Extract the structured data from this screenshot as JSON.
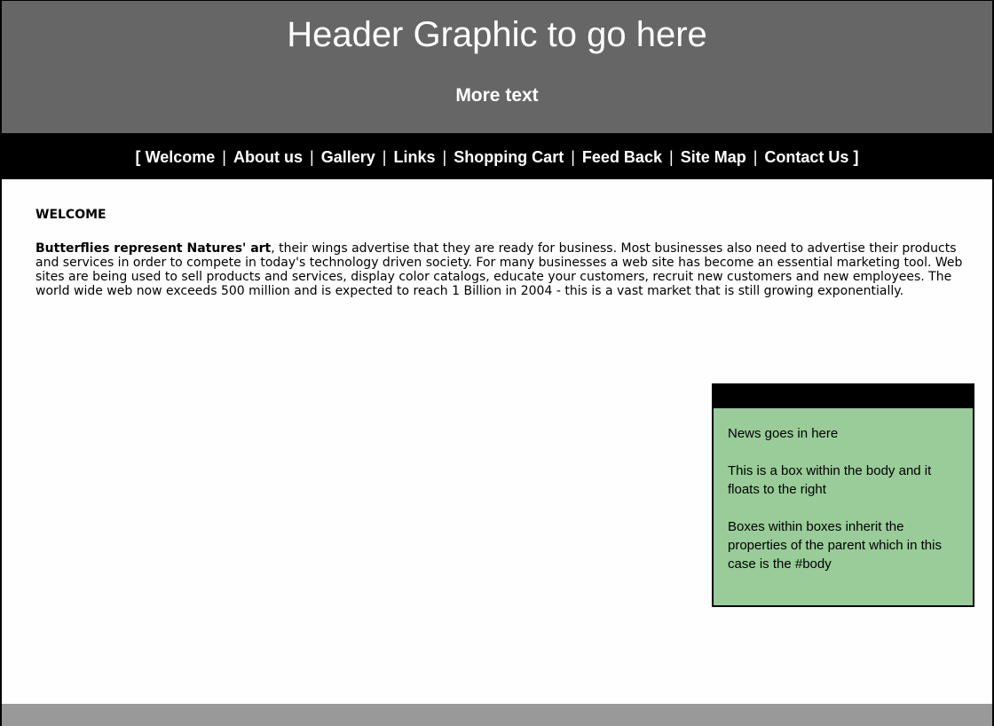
{
  "header": {
    "title": "Header Graphic to go here",
    "subtitle": "More text"
  },
  "nav": {
    "open_bracket": "[",
    "close_bracket": "]",
    "separator": "|",
    "items": [
      {
        "label": "Welcome"
      },
      {
        "label": "About us"
      },
      {
        "label": "Gallery"
      },
      {
        "label": "Links"
      },
      {
        "label": "Shopping Cart"
      },
      {
        "label": "Feed Back"
      },
      {
        "label": "Site Map"
      },
      {
        "label": "Contact Us"
      }
    ]
  },
  "content": {
    "section_title": "WELCOME",
    "intro_bold": "Butterflies represent Natures' art",
    "intro_rest": ", their wings advertise that they are ready for business. Most businesses also need to advertise their products and services in order to compete in today's technology driven society. For many businesses a web site has become an essential marketing tool. Web sites are being used to sell products and services, display color catalogs, educate your customers, recruit new customers and new employees. The world wide web now exceeds 500 million and is expected to reach 1 Billion in 2004 - this is a vast market that is still growing exponentially."
  },
  "news": {
    "lines": [
      "News goes in here",
      "This is a box within the body and it floats to the right",
      "Boxes within boxes inherit the properties of the parent which in this case is the #body"
    ]
  },
  "colors": {
    "header_bg": "#666666",
    "nav_bg": "#000000",
    "news_bg": "#99cc99",
    "footer_bg": "#999999"
  }
}
